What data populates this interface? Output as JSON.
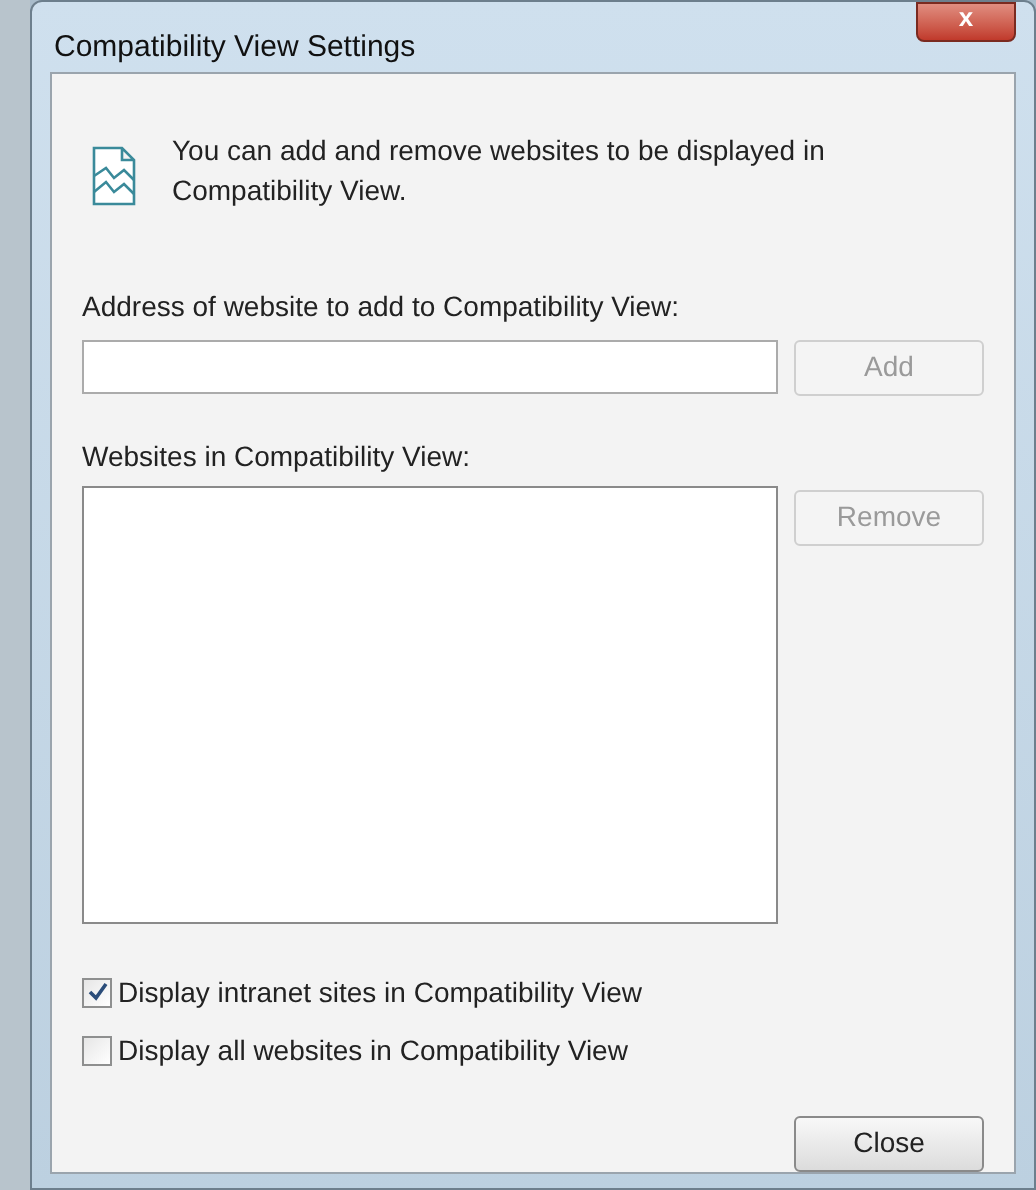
{
  "window": {
    "title": "Compatibility View Settings",
    "close_symbol": "x"
  },
  "intro": "You can add and remove websites to be displayed in Compatibility View.",
  "address": {
    "label": "Address of website to add to Compatibility View:"
  },
  "add_button": {
    "label": "Add",
    "disabled": true
  },
  "list": {
    "label": "Websites in Compatibility View:"
  },
  "remove_button": {
    "label": "Remove",
    "disabled": true
  },
  "options": [
    {
      "label": "Display intranet sites in Compatibility View",
      "checked": true
    },
    {
      "label": "Display all websites in Compatibility View",
      "checked": false
    }
  ],
  "close_button": {
    "label": "Close",
    "disabled": false
  }
}
